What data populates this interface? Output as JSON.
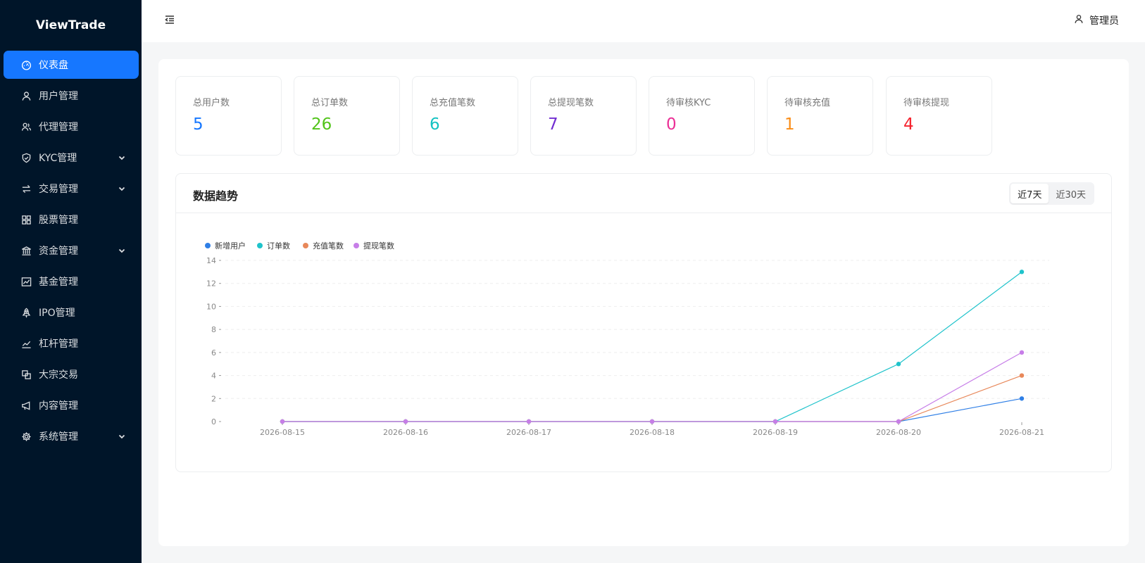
{
  "app": {
    "title": "ViewTrade"
  },
  "sidebar": {
    "items": [
      {
        "label": "仪表盘",
        "icon": "dashboard-icon",
        "active": true
      },
      {
        "label": "用户管理",
        "icon": "user-icon"
      },
      {
        "label": "代理管理",
        "icon": "agent-icon"
      },
      {
        "label": "KYC管理",
        "icon": "shield-icon",
        "expandable": true
      },
      {
        "label": "交易管理",
        "icon": "swap-icon",
        "expandable": true
      },
      {
        "label": "股票管理",
        "icon": "grid-icon"
      },
      {
        "label": "资金管理",
        "icon": "bank-icon",
        "expandable": true
      },
      {
        "label": "基金管理",
        "icon": "fund-chart-icon"
      },
      {
        "label": "IPO管理",
        "icon": "rocket-icon"
      },
      {
        "label": "杠杆管理",
        "icon": "line-chart-icon"
      },
      {
        "label": "大宗交易",
        "icon": "block-icon"
      },
      {
        "label": "内容管理",
        "icon": "megaphone-icon"
      },
      {
        "label": "系统管理",
        "icon": "gear-icon",
        "expandable": true
      }
    ]
  },
  "header": {
    "user_label": "管理员",
    "user_icon": "user-icon",
    "collapse_icon": "menu-fold-icon"
  },
  "stats": [
    {
      "label": "总用户数",
      "value": "5",
      "color": "#1677ff"
    },
    {
      "label": "总订单数",
      "value": "26",
      "color": "#52c41a"
    },
    {
      "label": "总充值笔数",
      "value": "6",
      "color": "#13c2c2"
    },
    {
      "label": "总提现笔数",
      "value": "7",
      "color": "#722ed1"
    },
    {
      "label": "待审核KYC",
      "value": "0",
      "color": "#eb2f96"
    },
    {
      "label": "待审核充值",
      "value": "1",
      "color": "#fa8c16"
    },
    {
      "label": "待审核提现",
      "value": "4",
      "color": "#f5222d"
    }
  ],
  "trend": {
    "title": "数据趋势",
    "ranges": [
      "近7天",
      "近30天"
    ],
    "selected_range": "近7天"
  },
  "chart_data": {
    "type": "line",
    "x": [
      "2026-08-15",
      "2026-08-16",
      "2026-08-17",
      "2026-08-18",
      "2026-08-19",
      "2026-08-20",
      "2026-08-21"
    ],
    "ylim": [
      0,
      14
    ],
    "yticks": [
      0,
      2,
      4,
      6,
      8,
      10,
      12,
      14
    ],
    "grid": true,
    "legend": "top-left",
    "series": [
      {
        "name": "新增用户",
        "color": "#2f7fe6",
        "values": [
          0,
          0,
          0,
          0,
          0,
          0,
          2
        ]
      },
      {
        "name": "订单数",
        "color": "#1fc3cb",
        "values": [
          0,
          0,
          0,
          0,
          0,
          5,
          13
        ]
      },
      {
        "name": "充值笔数",
        "color": "#e8885a",
        "values": [
          0,
          0,
          0,
          0,
          0,
          0,
          4
        ]
      },
      {
        "name": "提现笔数",
        "color": "#c77ee8",
        "values": [
          0,
          0,
          0,
          0,
          0,
          0,
          6
        ]
      }
    ]
  }
}
